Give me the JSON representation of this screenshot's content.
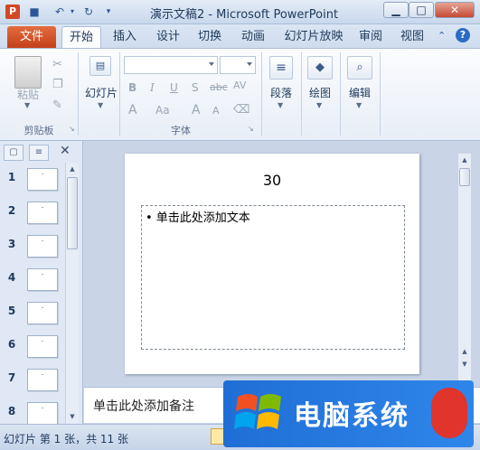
{
  "window": {
    "title": "演示文稿2 - Microsoft PowerPoint",
    "app_icon": "P",
    "minimize": "▁",
    "maximize": "□",
    "close": "✕"
  },
  "tabs": [
    {
      "label": "文件"
    },
    {
      "label": "开始"
    },
    {
      "label": "插入"
    },
    {
      "label": "设计"
    },
    {
      "label": "切换"
    },
    {
      "label": "动画"
    },
    {
      "label": "幻灯片放映"
    },
    {
      "label": "审阅"
    },
    {
      "label": "视图"
    }
  ],
  "ribbon": {
    "clipboard": {
      "paste": "粘贴",
      "group": "剪贴板"
    },
    "slides": {
      "label": "幻灯片"
    },
    "font": {
      "group": "字体",
      "bold": "B",
      "italic": "I",
      "underline": "U",
      "shadow": "S",
      "strike": "abc",
      "spacing": "AV",
      "color": "A",
      "case": "Aa",
      "grow": "A",
      "shrink": "A"
    },
    "paragraph": {
      "label": "段落"
    },
    "drawing": {
      "label": "绘图"
    },
    "editing": {
      "label": "编辑"
    }
  },
  "slides_panel": {
    "numbers": [
      "1",
      "2",
      "3",
      "4",
      "5",
      "6",
      "7",
      "8"
    ]
  },
  "slide": {
    "title": "30",
    "placeholder": "• 单击此处添加文本"
  },
  "notes": {
    "placeholder": "单击此处添加备注"
  },
  "status": {
    "text": "幻灯片 第 1 张，共 11 张"
  },
  "watermark": {
    "text": "电脑系统"
  }
}
